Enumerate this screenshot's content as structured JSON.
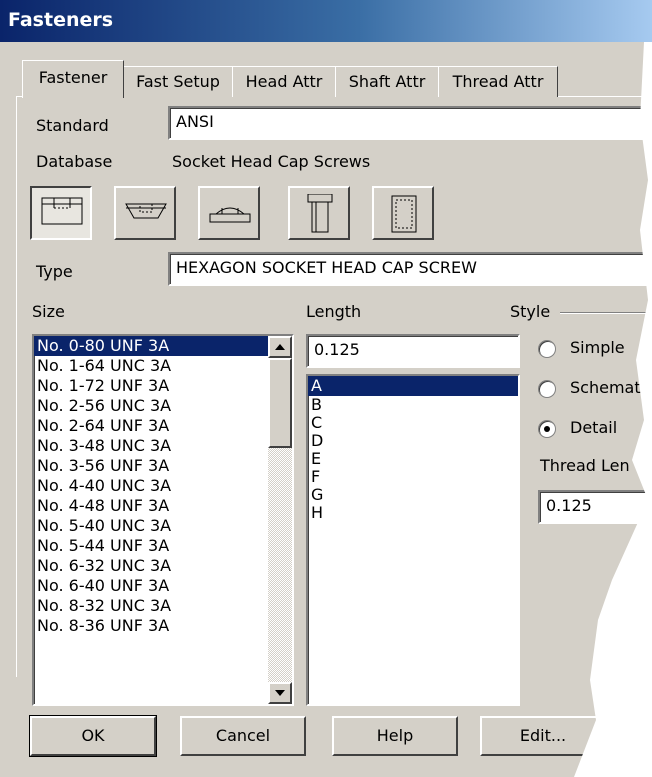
{
  "window": {
    "title": "Fasteners"
  },
  "tabs": [
    {
      "label": "Fastener"
    },
    {
      "label": "Fast Setup"
    },
    {
      "label": "Head Attr"
    },
    {
      "label": "Shaft Attr"
    },
    {
      "label": "Thread Attr"
    }
  ],
  "standard": {
    "label": "Standard",
    "value": "ANSI"
  },
  "database": {
    "label": "Database",
    "value": "Socket Head Cap Screws"
  },
  "type": {
    "label": "Type",
    "value": "HEXAGON SOCKET HEAD CAP SCREW"
  },
  "size": {
    "label": "Size",
    "items": [
      "No. 0-80 UNF 3A",
      "No. 1-64 UNC 3A",
      "No. 1-72 UNF 3A",
      "No. 2-56 UNC 3A",
      "No. 2-64 UNF 3A",
      "No. 3-48 UNC 3A",
      "No. 3-56 UNF 3A",
      "No. 4-40 UNC 3A",
      "No. 4-48 UNF 3A",
      "No. 5-40 UNC 3A",
      "No. 5-44 UNF 3A",
      "No. 6-32 UNC 3A",
      "No. 6-40 UNF 3A",
      "No. 8-32 UNC 3A",
      "No. 8-36 UNF 3A"
    ],
    "selected": "No. 0-80 UNF 3A"
  },
  "length": {
    "label": "Length",
    "value": "0.125",
    "items": [
      "A",
      "B",
      "C",
      "D",
      "E",
      "F",
      "G",
      "H"
    ],
    "selected": "A"
  },
  "style": {
    "label": "Style",
    "options": [
      "Simple",
      "Schemati",
      "Detail"
    ],
    "selected": "Detail"
  },
  "thread_length": {
    "label": "Thread Len",
    "value": "0.125"
  },
  "buttons": {
    "ok": "OK",
    "cancel": "Cancel",
    "help": "Help",
    "edit": "Edit..."
  }
}
